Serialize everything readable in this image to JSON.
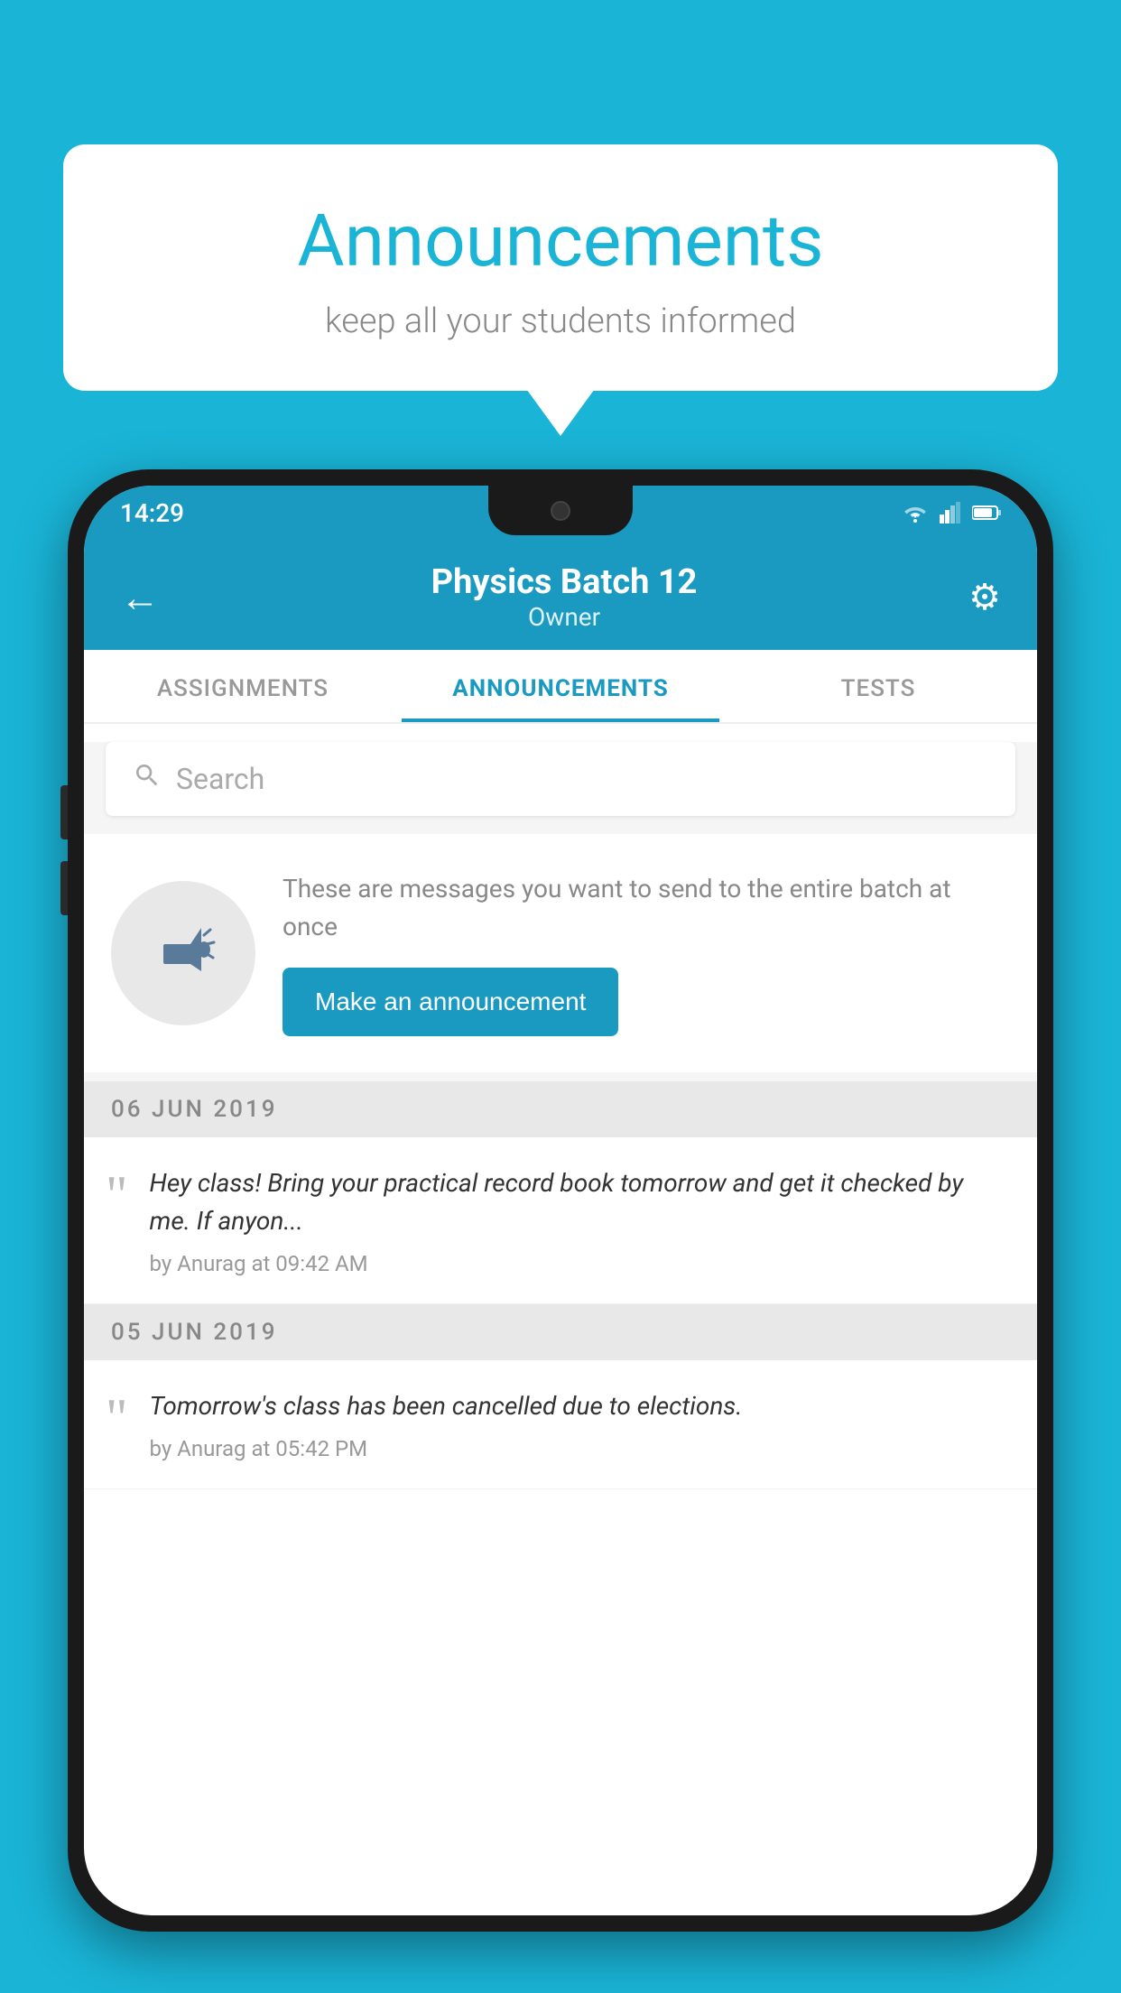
{
  "background_color": "#1ab4d7",
  "bubble": {
    "title": "Announcements",
    "subtitle": "keep all your students informed"
  },
  "phone": {
    "status_bar": {
      "time": "14:29",
      "icons": [
        "wifi",
        "signal",
        "battery"
      ]
    },
    "header": {
      "title": "Physics Batch 12",
      "subtitle": "Owner",
      "back_label": "←",
      "gear_label": "⚙"
    },
    "tabs": [
      {
        "label": "ASSIGNMENTS",
        "active": false
      },
      {
        "label": "ANNOUNCEMENTS",
        "active": true
      },
      {
        "label": "TESTS",
        "active": false
      }
    ],
    "search": {
      "placeholder": "Search"
    },
    "promo": {
      "description": "These are messages you want to send to the entire batch at once",
      "button_label": "Make an announcement"
    },
    "announcements": [
      {
        "date": "06  JUN  2019",
        "text": "Hey class! Bring your practical record book tomorrow and get it checked by me. If anyon...",
        "meta": "by Anurag at 09:42 AM"
      },
      {
        "date": "05  JUN  2019",
        "text": "Tomorrow's class has been cancelled due to elections.",
        "meta": "by Anurag at 05:42 PM"
      }
    ]
  }
}
